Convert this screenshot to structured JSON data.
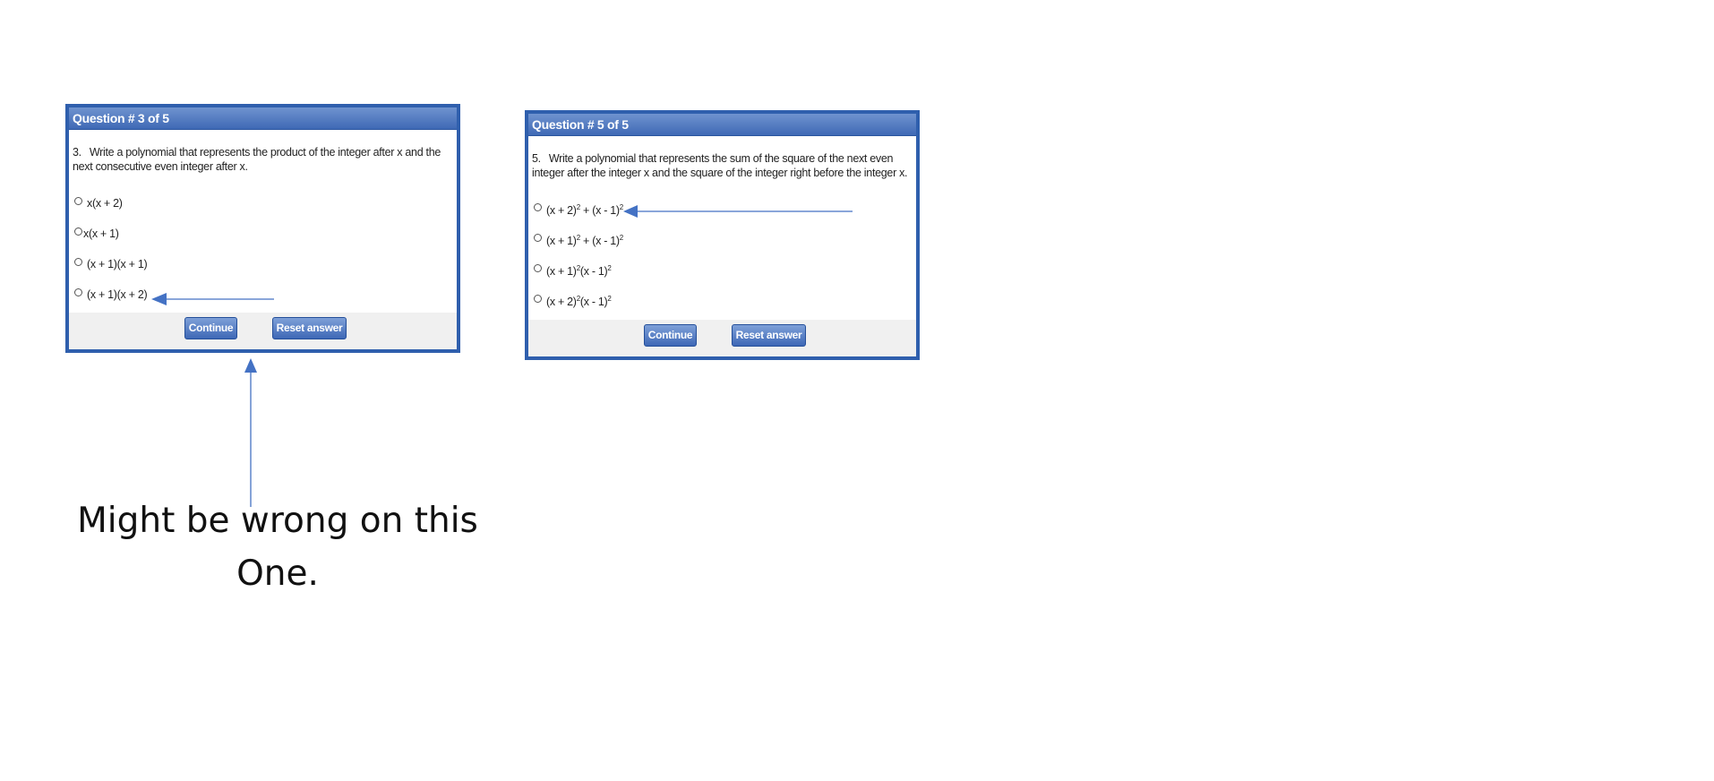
{
  "panels": {
    "q3": {
      "header": "Question # 3 of 5",
      "number": "3.",
      "question": "Write a polynomial that represents the product of the integer after x and the next consecutive even integer after x.",
      "options": [
        "x(x + 2)",
        "x(x + 1)",
        "(x + 1)(x + 1)",
        "(x + 1)(x + 2)"
      ],
      "continue_label": "Continue",
      "reset_label": "Reset answer"
    },
    "q5": {
      "header": "Question # 5 of 5",
      "number": "5.",
      "question": "Write a polynomial that represents the sum of the square of the next even integer after the integer x and the square of the integer right before the integer x.",
      "options": [
        {
          "a": "(x + 2)",
          "a_exp": "2",
          "op": " + ",
          "b": "(x - 1)",
          "b_exp": "2"
        },
        {
          "a": "(x + 1)",
          "a_exp": "2",
          "op": " + ",
          "b": "(x - 1)",
          "b_exp": "2"
        },
        {
          "a": "(x + 1)",
          "a_exp": "2",
          "op": "",
          "b": "(x - 1)",
          "b_exp": "2"
        },
        {
          "a": "(x + 2)",
          "a_exp": "2",
          "op": "",
          "b": "(x - 1)",
          "b_exp": "2"
        }
      ],
      "continue_label": "Continue",
      "reset_label": "Reset answer"
    }
  },
  "annotation": {
    "line1": "Might be wrong on this",
    "line2": "One."
  },
  "colors": {
    "panel_border": "#2f5fad",
    "arrow": "#4472c4",
    "button": "#3e68b6"
  }
}
